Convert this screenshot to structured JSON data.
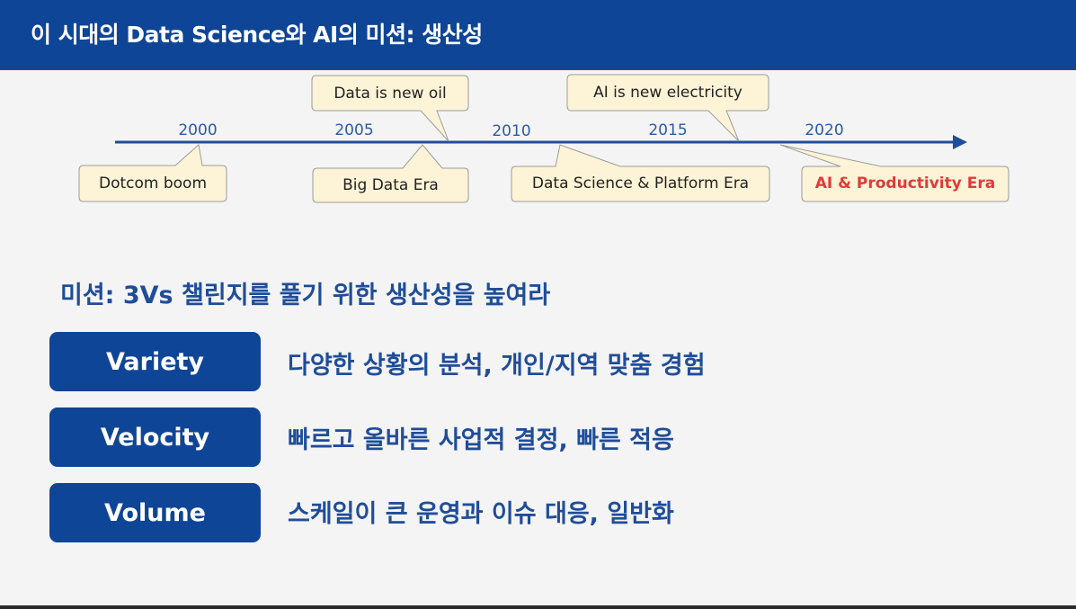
{
  "header": {
    "title": "이 시대의 Data Science와 AI의 미션: 생산성"
  },
  "timeline": {
    "years": [
      "2000",
      "2005",
      "2010",
      "2015",
      "2020"
    ],
    "events_above": [
      "Data is new oil",
      "AI is new electricity"
    ],
    "events_below": [
      "Dotcom boom",
      "Big Data Era",
      "Data Science & Platform Era",
      "AI & Productivity Era"
    ]
  },
  "mission": {
    "text": "미션:  3Vs 챌린지를 풀기 위한 생산성을 높여라"
  },
  "vs": [
    {
      "label": "Variety",
      "description": "다양한 상황의 분석,  개인/지역 맞춤 경험"
    },
    {
      "label": "Velocity",
      "description": "빠르고 올바른 사업적 결정,  빠른 적응"
    },
    {
      "label": "Volume",
      "description": "스케일이 큰 운영과 이슈 대응,   일반화"
    }
  ],
  "colors": {
    "header_bg": "#0f4596",
    "accent_text": "#1f4d99",
    "callout_fill": "#fdf3d6",
    "highlight": "#e03a3a"
  }
}
